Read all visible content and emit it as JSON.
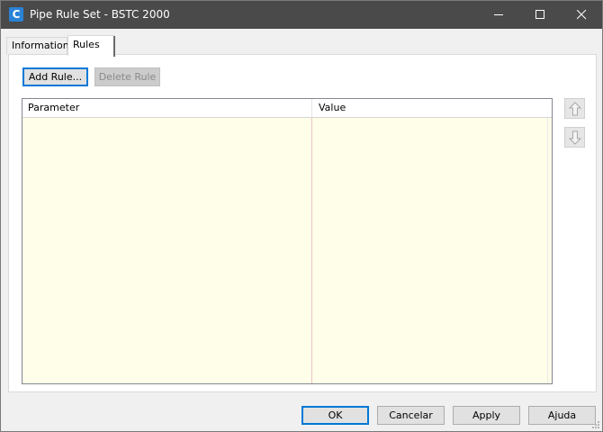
{
  "window": {
    "title": "Pipe Rule Set - BSTC 2000",
    "app_icon_letter": "C"
  },
  "tabs": [
    {
      "label": "Information",
      "active": false
    },
    {
      "label": "Rules",
      "active": true
    }
  ],
  "toolbar": {
    "add_rule_label": "Add Rule...",
    "delete_rule_label": "Delete Rule"
  },
  "grid": {
    "columns": [
      "Parameter",
      "Value"
    ],
    "rows": []
  },
  "footer": {
    "ok_label": "OK",
    "cancel_label": "Cancelar",
    "apply_label": "Apply",
    "help_label": "Ajuda"
  },
  "colors": {
    "titlebar": "#4a4a4a",
    "grid_background": "#fefee9",
    "accent": "#0078d7"
  }
}
